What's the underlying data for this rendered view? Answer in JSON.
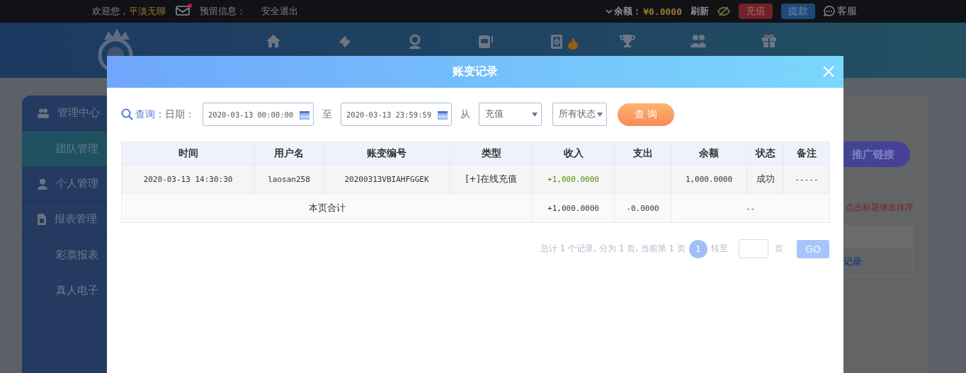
{
  "top_bar": {
    "greeting": "欢迎您，",
    "username": "平淡无聊",
    "mail_unread": true,
    "reserved_info": "预留信息：",
    "logout": "安全退出",
    "balance_label": "余额：",
    "balance": "¥0.0000",
    "refresh": "刷新",
    "deposit": "充值",
    "withdraw": "提款",
    "support": "客服"
  },
  "header": {
    "nav": [
      {
        "kind": "home",
        "hot": false
      },
      {
        "kind": "ticket",
        "hot": false
      },
      {
        "kind": "dealer",
        "hot": false
      },
      {
        "kind": "slot",
        "hot": false
      },
      {
        "kind": "mahjong",
        "hot": true
      },
      {
        "kind": "trophy",
        "hot": false
      },
      {
        "kind": "people",
        "hot": false
      },
      {
        "kind": "gift",
        "hot": false
      }
    ]
  },
  "sidebar": {
    "items": [
      {
        "label": "管理中心",
        "kind": "team",
        "selected": false
      },
      {
        "label": "团队管理",
        "kind": "sub",
        "selected": true
      },
      {
        "label": "个人管理",
        "kind": "personal",
        "selected": false
      },
      {
        "label": "报表管理",
        "kind": "report",
        "selected": false
      },
      {
        "label": "彩票报表",
        "kind": "sub",
        "selected": false
      },
      {
        "label": "真人电子",
        "kind": "sub",
        "selected": false
      }
    ]
  },
  "content": {
    "promo_button": "推广链接",
    "sort_hint": "点击标题修改排序",
    "table_link": "记录"
  },
  "dialog": {
    "title": "账变记录",
    "query_label": "查询：",
    "date_label": "日期：",
    "start_date": "2020-03-13 00:00:00",
    "to_label": "至",
    "end_date": "2020-03-13 23:59:59",
    "from_label": "从",
    "type_select": "充值",
    "status_select": "所有状态",
    "search_button": "查 询",
    "table": {
      "columns": [
        {
          "label": "时间",
          "kind": "text"
        },
        {
          "label": "用户名",
          "kind": "text"
        },
        {
          "label": "账变编号",
          "kind": "text"
        },
        {
          "label": "类型",
          "kind": "text"
        },
        {
          "label": "收入",
          "kind": "income"
        },
        {
          "label": "支出",
          "kind": "text"
        },
        {
          "label": "余额",
          "kind": "text"
        },
        {
          "label": "状态",
          "kind": "text"
        },
        {
          "label": "备注",
          "kind": "text"
        }
      ],
      "rows": [
        {
          "cells": [
            "2020-03-13 14:30:30",
            "laosan258",
            "20200313VBIAHFGGEK",
            "[+]在线充值",
            "+1,000.0000",
            "",
            "1,000.0000",
            "成功",
            "-----"
          ]
        }
      ],
      "total": {
        "label": "本页合计",
        "income": "+1,000.0000",
        "expense": "-0.0000",
        "rest": "--"
      }
    },
    "pagination": {
      "summary": "总计 1 个记录, 分为 1 页, 当前第 1 页",
      "pages": [
        {
          "label": "1",
          "selected": true
        }
      ],
      "goto_label": "转至",
      "page_unit": "页",
      "go_button": "GO"
    }
  }
}
